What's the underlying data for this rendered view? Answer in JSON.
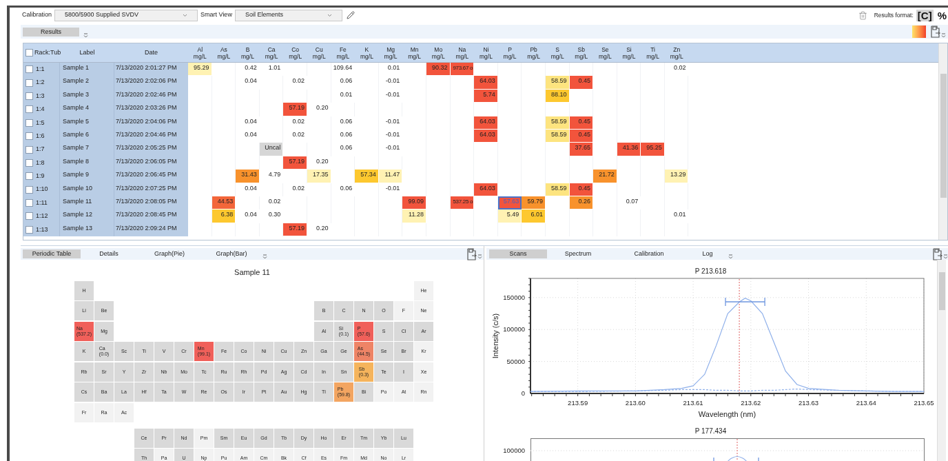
{
  "toolbar": {
    "calibration_label": "Calibration",
    "calibration_value": "5800/5900 Supplied SVDV",
    "smart_view_label": "Smart View",
    "smart_view_value": "Soil Elements",
    "results_format_label": "Results format:",
    "formats": [
      {
        "label": "[C]",
        "selected": true
      },
      {
        "label": "%",
        "selected": false
      }
    ]
  },
  "results_tabs": [
    {
      "label": "Results",
      "selected": true
    }
  ],
  "table": {
    "fixed_columns": [
      "Rack:Tub",
      "Label",
      "Date"
    ],
    "header_checked": false,
    "columns": [
      {
        "name": "Al",
        "unit": "mg/L"
      },
      {
        "name": "As",
        "unit": "mg/L"
      },
      {
        "name": "B",
        "unit": "mg/L"
      },
      {
        "name": "Ca",
        "unit": "mg/L"
      },
      {
        "name": "Co",
        "unit": "mg/L"
      },
      {
        "name": "Cu",
        "unit": "mg/L"
      },
      {
        "name": "Fe",
        "unit": "mg/L"
      },
      {
        "name": "K",
        "unit": "mg/L"
      },
      {
        "name": "Mg",
        "unit": "mg/L"
      },
      {
        "name": "Mn",
        "unit": "mg/L"
      },
      {
        "name": "Mo",
        "unit": "mg/L"
      },
      {
        "name": "Na",
        "unit": "mg/L"
      },
      {
        "name": "Ni",
        "unit": "mg/L"
      },
      {
        "name": "P",
        "unit": "mg/L"
      },
      {
        "name": "Pb",
        "unit": "mg/L"
      },
      {
        "name": "S",
        "unit": "mg/L"
      },
      {
        "name": "Sb",
        "unit": "mg/L"
      },
      {
        "name": "Se",
        "unit": "mg/L"
      },
      {
        "name": "Si",
        "unit": "mg/L"
      },
      {
        "name": "Ti",
        "unit": "mg/L"
      },
      {
        "name": "Zn",
        "unit": "mg/L"
      }
    ],
    "rows": [
      {
        "rack": "1:1",
        "label": "Sample 1",
        "date": "7/13/2020 2:01:27 PM",
        "checked": false,
        "cells": [
          {
            "text": "95.29",
            "color": "#fff2b3",
            "selected": false
          },
          null,
          {
            "text": "0.42",
            "selected": false
          },
          {
            "text": "1.01",
            "selected": false
          },
          null,
          null,
          {
            "text": "109.64",
            "selected": false
          },
          null,
          {
            "text": "0.01",
            "selected": false
          },
          null,
          {
            "text": "90.32",
            "color": "#f2543c",
            "selected": false
          },
          {
            "text": "973.67 o",
            "color": "#f2543c",
            "selected": false
          },
          null,
          null,
          null,
          null,
          null,
          null,
          null,
          null,
          {
            "text": "0.02",
            "selected": false
          }
        ]
      },
      {
        "rack": "1:2",
        "label": "Sample 2",
        "date": "7/13/2020 2:02:06 PM",
        "checked": false,
        "cells": [
          null,
          null,
          {
            "text": "0.04",
            "selected": false
          },
          null,
          {
            "text": "0.02",
            "selected": false
          },
          null,
          {
            "text": "0.06",
            "selected": false
          },
          null,
          {
            "text": "-0.01",
            "selected": false
          },
          null,
          null,
          null,
          {
            "text": "64.03",
            "color": "#f2543c",
            "selected": false
          },
          null,
          null,
          {
            "text": "58.59",
            "color": "#fde47f",
            "selected": false
          },
          {
            "text": "0.45",
            "color": "#f2543c",
            "selected": false
          },
          null,
          null,
          null,
          null
        ]
      },
      {
        "rack": "1:3",
        "label": "Sample 3",
        "date": "7/13/2020 2:02:46 PM",
        "checked": false,
        "cells": [
          null,
          null,
          null,
          null,
          null,
          null,
          {
            "text": "0.01",
            "selected": false
          },
          null,
          {
            "text": "-0.01",
            "selected": false
          },
          null,
          null,
          null,
          {
            "text": "5.74",
            "color": "#f2543c",
            "selected": false
          },
          null,
          null,
          {
            "text": "88.10",
            "color": "#fdc82f",
            "selected": false
          },
          null,
          null,
          null,
          null,
          null
        ]
      },
      {
        "rack": "1:4",
        "label": "Sample 4",
        "date": "7/13/2020 2:03:26 PM",
        "checked": false,
        "cells": [
          null,
          null,
          null,
          null,
          {
            "text": "57.19",
            "color": "#f2543c",
            "selected": false
          },
          {
            "text": "0.20",
            "selected": false
          },
          null,
          null,
          null,
          null,
          null,
          null,
          null,
          null,
          null,
          null,
          null,
          null,
          null,
          null,
          null
        ]
      },
      {
        "rack": "1:5",
        "label": "Sample 5",
        "date": "7/13/2020 2:04:06 PM",
        "checked": false,
        "cells": [
          null,
          null,
          {
            "text": "0.04",
            "selected": false
          },
          null,
          {
            "text": "0.02",
            "selected": false
          },
          null,
          {
            "text": "0.06",
            "selected": false
          },
          null,
          {
            "text": "-0.01",
            "selected": false
          },
          null,
          null,
          null,
          {
            "text": "64.03",
            "color": "#f2543c",
            "selected": false
          },
          null,
          null,
          {
            "text": "58.59",
            "color": "#fde47f",
            "selected": false
          },
          {
            "text": "0.45",
            "color": "#f2543c",
            "selected": false
          },
          null,
          null,
          null,
          null
        ]
      },
      {
        "rack": "1:6",
        "label": "Sample 6",
        "date": "7/13/2020 2:04:46 PM",
        "checked": false,
        "cells": [
          null,
          null,
          {
            "text": "0.04",
            "selected": false
          },
          null,
          {
            "text": "0.02",
            "selected": false
          },
          null,
          {
            "text": "0.06",
            "selected": false
          },
          null,
          {
            "text": "-0.01",
            "selected": false
          },
          null,
          null,
          null,
          {
            "text": "64.03",
            "color": "#f2543c",
            "selected": false
          },
          null,
          null,
          {
            "text": "58.59",
            "color": "#fde47f",
            "selected": false
          },
          {
            "text": "0.45",
            "color": "#f2543c",
            "selected": false
          },
          null,
          null,
          null,
          null
        ]
      },
      {
        "rack": "1:7",
        "label": "Sample 7",
        "date": "7/13/2020 2:05:25 PM",
        "checked": false,
        "cells": [
          null,
          null,
          null,
          {
            "text": "Uncal",
            "color": "#d6d6d6",
            "selected": false
          },
          null,
          null,
          {
            "text": "0.06",
            "selected": false
          },
          null,
          {
            "text": "-0.01",
            "selected": false
          },
          null,
          null,
          null,
          null,
          null,
          null,
          null,
          {
            "text": "37.65",
            "color": "#f2543c",
            "selected": false
          },
          null,
          {
            "text": "41.36",
            "color": "#f2543c",
            "selected": false
          },
          {
            "text": "95.25",
            "color": "#f2543c",
            "selected": false
          },
          null
        ]
      },
      {
        "rack": "1:8",
        "label": "Sample 8",
        "date": "7/13/2020 2:06:05 PM",
        "checked": false,
        "cells": [
          null,
          null,
          null,
          null,
          {
            "text": "57.19",
            "color": "#f2543c",
            "selected": false
          },
          {
            "text": "0.20",
            "selected": false
          },
          null,
          null,
          null,
          null,
          null,
          null,
          null,
          null,
          null,
          null,
          null,
          null,
          null,
          null,
          null
        ]
      },
      {
        "rack": "1:9",
        "label": "Sample 9",
        "date": "7/13/2020 2:06:45 PM",
        "checked": false,
        "cells": [
          null,
          null,
          {
            "text": "31.43",
            "color": "#f8922c",
            "selected": false
          },
          {
            "text": "4.79",
            "selected": false
          },
          null,
          {
            "text": "17.35",
            "color": "#fff2b3",
            "selected": false
          },
          null,
          {
            "text": "57.34",
            "color": "#fdc82f",
            "selected": false
          },
          {
            "text": "11.47",
            "color": "#fff2b3",
            "selected": false
          },
          null,
          null,
          null,
          null,
          null,
          null,
          null,
          null,
          {
            "text": "21.72",
            "color": "#f8922c",
            "selected": false
          },
          null,
          null,
          {
            "text": "13.29",
            "color": "#fff2b3",
            "selected": false
          }
        ]
      },
      {
        "rack": "1:10",
        "label": "Sample 10",
        "date": "7/13/2020 2:07:25 PM",
        "checked": false,
        "cells": [
          null,
          null,
          {
            "text": "0.04",
            "selected": false
          },
          null,
          {
            "text": "0.02",
            "selected": false
          },
          null,
          {
            "text": "0.06",
            "selected": false
          },
          null,
          {
            "text": "-0.01",
            "selected": false
          },
          null,
          null,
          null,
          {
            "text": "64.03",
            "color": "#f2543c",
            "selected": false
          },
          null,
          null,
          {
            "text": "58.59",
            "color": "#fde47f",
            "selected": false
          },
          {
            "text": "0.45",
            "color": "#f2543c",
            "selected": false
          },
          null,
          null,
          null,
          null
        ]
      },
      {
        "rack": "1:11",
        "label": "Sample 11",
        "date": "7/13/2020 2:08:05 PM",
        "checked": false,
        "cells": [
          null,
          {
            "text": "44.53",
            "color": "#f3663a",
            "selected": false
          },
          null,
          {
            "text": "0.02",
            "selected": false
          },
          null,
          null,
          null,
          null,
          null,
          {
            "text": "99.09",
            "color": "#f2543c",
            "selected": false
          },
          null,
          {
            "text": "537.25 o",
            "color": "#f2543c",
            "selected": false
          },
          null,
          {
            "text": "57.63",
            "color": "#f2543c",
            "selected": true
          },
          {
            "text": "59.79",
            "color": "#f8922c",
            "selected": false
          },
          null,
          {
            "text": "0.26",
            "color": "#f8922c",
            "selected": false
          },
          null,
          {
            "text": "0.07",
            "selected": false
          },
          null,
          null
        ]
      },
      {
        "rack": "1:12",
        "label": "Sample 12",
        "date": "7/13/2020 2:08:45 PM",
        "checked": false,
        "cells": [
          null,
          {
            "text": "6.38",
            "color": "#fdc82f",
            "selected": false
          },
          {
            "text": "0.04",
            "selected": false
          },
          {
            "text": "0.30",
            "selected": false
          },
          null,
          null,
          null,
          null,
          null,
          {
            "text": "11.28",
            "color": "#fff2b3",
            "selected": false
          },
          null,
          null,
          null,
          {
            "text": "5.49",
            "color": "#fff2b3",
            "selected": false
          },
          {
            "text": "6.01",
            "color": "#fdc82f",
            "selected": false
          },
          null,
          null,
          null,
          null,
          null,
          {
            "text": "0.01",
            "selected": false
          }
        ]
      },
      {
        "rack": "1:13",
        "label": "Sample 13",
        "date": "7/13/2020 2:09:24 PM",
        "checked": false,
        "cells": [
          null,
          null,
          null,
          null,
          {
            "text": "57.19",
            "color": "#f2543c",
            "selected": false
          },
          {
            "text": "0.20",
            "selected": false
          },
          null,
          null,
          null,
          null,
          null,
          null,
          null,
          null,
          null,
          null,
          null,
          null,
          null,
          null,
          null
        ]
      }
    ]
  },
  "periodic_panel": {
    "tabs": [
      {
        "label": "Periodic Table",
        "selected": true
      },
      {
        "label": "Details",
        "selected": false
      },
      {
        "label": "Graph(Pie)",
        "selected": false
      },
      {
        "label": "Graph(Bar)",
        "selected": false
      }
    ],
    "title": "Sample 11",
    "main_rows": [
      [
        {
          "symbol": "H",
          "color": "#d9d9d9"
        },
        null,
        null,
        null,
        null,
        null,
        null,
        null,
        null,
        null,
        null,
        null,
        null,
        null,
        null,
        null,
        null,
        {
          "symbol": "He",
          "color": "#f2f2f2"
        }
      ],
      [
        {
          "symbol": "Li",
          "color": "#d9d9d9"
        },
        {
          "symbol": "Be",
          "color": "#d9d9d9"
        },
        null,
        null,
        null,
        null,
        null,
        null,
        null,
        null,
        null,
        null,
        {
          "symbol": "B",
          "color": "#d9d9d9"
        },
        {
          "symbol": "C",
          "color": "#d9d9d9"
        },
        {
          "symbol": "N",
          "color": "#d9d9d9"
        },
        {
          "symbol": "O",
          "color": "#d9d9d9"
        },
        {
          "symbol": "F",
          "color": "#f2f2f2"
        },
        {
          "symbol": "Ne",
          "color": "#f2f2f2"
        }
      ],
      [
        {
          "symbol": "Na",
          "value": "(537.2)",
          "color": "#f0605a"
        },
        {
          "symbol": "Mg",
          "color": "#d9d9d9"
        },
        null,
        null,
        null,
        null,
        null,
        null,
        null,
        null,
        null,
        null,
        {
          "symbol": "Al",
          "color": "#d9d9d9"
        },
        {
          "symbol": "Si",
          "value": "(0.1)",
          "color": "#d9d9d9"
        },
        {
          "symbol": "P",
          "value": "(57.6)",
          "color": "#f0605a"
        },
        {
          "symbol": "S",
          "color": "#d9d9d9"
        },
        {
          "symbol": "Cl",
          "color": "#d9d9d9"
        },
        {
          "symbol": "Ar",
          "color": "#d9d9d9"
        }
      ],
      [
        {
          "symbol": "K",
          "color": "#d9d9d9"
        },
        {
          "symbol": "Ca",
          "value": "(0.0)",
          "color": "#d9d9d9"
        },
        {
          "symbol": "Sc",
          "color": "#d9d9d9"
        },
        {
          "symbol": "Ti",
          "color": "#d9d9d9"
        },
        {
          "symbol": "V",
          "color": "#d9d9d9"
        },
        {
          "symbol": "Cr",
          "color": "#d9d9d9"
        },
        {
          "symbol": "Mn",
          "value": "(99.1)",
          "color": "#f0605a"
        },
        {
          "symbol": "Fe",
          "color": "#d9d9d9"
        },
        {
          "symbol": "Co",
          "color": "#d9d9d9"
        },
        {
          "symbol": "Ni",
          "color": "#d9d9d9"
        },
        {
          "symbol": "Cu",
          "color": "#d9d9d9"
        },
        {
          "symbol": "Zn",
          "color": "#d9d9d9"
        },
        {
          "symbol": "Ga",
          "color": "#d9d9d9"
        },
        {
          "symbol": "Ge",
          "color": "#d9d9d9"
        },
        {
          "symbol": "As",
          "value": "(44.5)",
          "color": "#ee8466"
        },
        {
          "symbol": "Se",
          "color": "#d9d9d9"
        },
        {
          "symbol": "Br",
          "color": "#d9d9d9"
        },
        {
          "symbol": "Kr",
          "color": "#f2f2f2"
        }
      ],
      [
        {
          "symbol": "Rb",
          "color": "#d9d9d9"
        },
        {
          "symbol": "Sr",
          "color": "#d9d9d9"
        },
        {
          "symbol": "Y",
          "color": "#d9d9d9"
        },
        {
          "symbol": "Zr",
          "color": "#d9d9d9"
        },
        {
          "symbol": "Nb",
          "color": "#d9d9d9"
        },
        {
          "symbol": "Mo",
          "color": "#d9d9d9"
        },
        {
          "symbol": "Tc",
          "color": "#d9d9d9"
        },
        {
          "symbol": "Ru",
          "color": "#d9d9d9"
        },
        {
          "symbol": "Rh",
          "color": "#d9d9d9"
        },
        {
          "symbol": "Pd",
          "color": "#d9d9d9"
        },
        {
          "symbol": "Ag",
          "color": "#d9d9d9"
        },
        {
          "symbol": "Cd",
          "color": "#d9d9d9"
        },
        {
          "symbol": "In",
          "color": "#d9d9d9"
        },
        {
          "symbol": "Sn",
          "color": "#d9d9d9"
        },
        {
          "symbol": "Sb",
          "value": "(0.3)",
          "color": "#f5b45c"
        },
        {
          "symbol": "Te",
          "color": "#d9d9d9"
        },
        {
          "symbol": "I",
          "color": "#d9d9d9"
        },
        {
          "symbol": "Xe",
          "color": "#f2f2f2"
        }
      ],
      [
        {
          "symbol": "Cs",
          "color": "#d9d9d9"
        },
        {
          "symbol": "Ba",
          "color": "#d9d9d9"
        },
        {
          "symbol": "La",
          "color": "#d9d9d9"
        },
        {
          "symbol": "Hf",
          "color": "#d9d9d9"
        },
        {
          "symbol": "Ta",
          "color": "#d9d9d9"
        },
        {
          "symbol": "W",
          "color": "#d9d9d9"
        },
        {
          "symbol": "Re",
          "color": "#d9d9d9"
        },
        {
          "symbol": "Os",
          "color": "#d9d9d9"
        },
        {
          "symbol": "Ir",
          "color": "#d9d9d9"
        },
        {
          "symbol": "Pt",
          "color": "#d9d9d9"
        },
        {
          "symbol": "Au",
          "color": "#d9d9d9"
        },
        {
          "symbol": "Hg",
          "color": "#d9d9d9"
        },
        {
          "symbol": "Tl",
          "color": "#d9d9d9"
        },
        {
          "symbol": "Pb",
          "value": "(59.8)",
          "color": "#f3a561"
        },
        {
          "symbol": "Bi",
          "color": "#d9d9d9"
        },
        {
          "symbol": "Po",
          "color": "#f2f2f2"
        },
        {
          "symbol": "At",
          "color": "#f2f2f2"
        },
        {
          "symbol": "Rn",
          "color": "#f2f2f2"
        }
      ],
      [
        {
          "symbol": "Fr",
          "color": "#f2f2f2"
        },
        {
          "symbol": "Ra",
          "color": "#f2f2f2"
        },
        {
          "symbol": "Ac",
          "color": "#f2f2f2"
        }
      ]
    ],
    "f_rows": [
      [
        null,
        null,
        null,
        {
          "symbol": "Ce",
          "color": "#d9d9d9"
        },
        {
          "symbol": "Pr",
          "color": "#d9d9d9"
        },
        {
          "symbol": "Nd",
          "color": "#d9d9d9"
        },
        {
          "symbol": "Pm",
          "color": "#f2f2f2"
        },
        {
          "symbol": "Sm",
          "color": "#d9d9d9"
        },
        {
          "symbol": "Eu",
          "color": "#d9d9d9"
        },
        {
          "symbol": "Gd",
          "color": "#d9d9d9"
        },
        {
          "symbol": "Tb",
          "color": "#d9d9d9"
        },
        {
          "symbol": "Dy",
          "color": "#d9d9d9"
        },
        {
          "symbol": "Ho",
          "color": "#d9d9d9"
        },
        {
          "symbol": "Er",
          "color": "#d9d9d9"
        },
        {
          "symbol": "Tm",
          "color": "#d9d9d9"
        },
        {
          "symbol": "Yb",
          "color": "#d9d9d9"
        },
        {
          "symbol": "Lu",
          "color": "#d9d9d9"
        }
      ],
      [
        null,
        null,
        null,
        {
          "symbol": "Th",
          "color": "#d9d9d9"
        },
        {
          "symbol": "Pa",
          "color": "#f2f2f2"
        },
        {
          "symbol": "U",
          "color": "#d9d9d9"
        },
        {
          "symbol": "Np",
          "color": "#f2f2f2"
        },
        {
          "symbol": "Pu",
          "color": "#f2f2f2"
        },
        {
          "symbol": "Am",
          "color": "#f2f2f2"
        },
        {
          "symbol": "Cm",
          "color": "#f2f2f2"
        },
        {
          "symbol": "Bk",
          "color": "#f2f2f2"
        },
        {
          "symbol": "Cf",
          "color": "#f2f2f2"
        },
        {
          "symbol": "Es",
          "color": "#f2f2f2"
        },
        {
          "symbol": "Fm",
          "color": "#f2f2f2"
        },
        {
          "symbol": "Md",
          "color": "#f2f2f2"
        },
        {
          "symbol": "No",
          "color": "#f2f2f2"
        },
        {
          "symbol": "Lr",
          "color": "#f2f2f2"
        }
      ]
    ]
  },
  "scans_panel": {
    "tabs": [
      {
        "label": "Scans",
        "selected": true
      },
      {
        "label": "Spectrum",
        "selected": false
      },
      {
        "label": "Calibration",
        "selected": false
      },
      {
        "label": "Log",
        "selected": false
      }
    ],
    "charts": [
      {
        "chart_data": {
          "type": "line",
          "title": "P 213.618",
          "xlabel": "Wavelength (nm)",
          "ylabel": "Intensity (c/s)",
          "xlim": [
            213.5818,
            213.65
          ],
          "ylim": [
            0,
            180000
          ],
          "xticks": [
            {
              "value": 213.59,
              "label": "213.59"
            },
            {
              "value": 213.6,
              "label": "213.60"
            },
            {
              "value": 213.61,
              "label": "213.61"
            },
            {
              "value": 213.62,
              "label": "213.62"
            },
            {
              "value": 213.63,
              "label": "213.63"
            },
            {
              "value": 213.64,
              "label": "213.64"
            },
            {
              "value": 213.65,
              "label": "213.65"
            }
          ],
          "yticks": [
            0,
            50000,
            100000,
            150000
          ],
          "x": [
            213.5818,
            213.59,
            213.6,
            213.605,
            213.608,
            213.61,
            213.612,
            213.614,
            213.616,
            213.618,
            213.619,
            213.62,
            213.622,
            213.624,
            213.626,
            213.628,
            213.63,
            213.635,
            213.64,
            213.645,
            213.65
          ],
          "series": [
            {
              "color": "#8fb0ea",
              "values": [
                3000,
                4000,
                4000,
                6000,
                8000,
                12000,
                30000,
                75000,
                125000,
                143000,
                149000,
                145000,
                125000,
                80000,
                35000,
                14000,
                8000,
                5000,
                4000,
                3000,
                3000
              ]
            },
            {
              "color": "#8fb0ea",
              "line_style": "dashed",
              "values": [
                3000,
                3000,
                4000,
                5000,
                6000,
                6000,
                6000,
                5000,
                5000,
                4000,
                4000,
                4000,
                5000,
                5000,
                6000,
                7000,
                6000,
                5000,
                4000,
                3000,
                3000
              ]
            }
          ],
          "grid": true,
          "ref_lines": [
            {
              "axis": "x",
              "value": 213.618
            }
          ]
        }
      },
      {
        "title": "P 177.434",
        "tick_label": "100000"
      }
    ]
  }
}
